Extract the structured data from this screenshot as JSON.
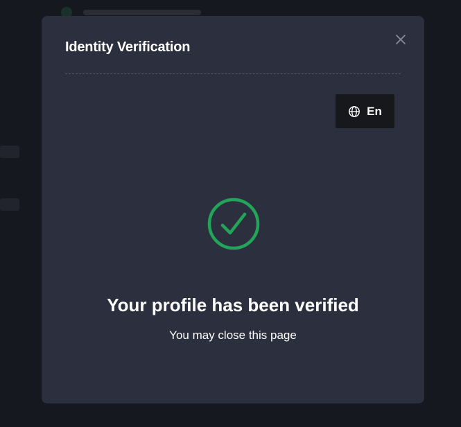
{
  "modal": {
    "title": "Identity Verification",
    "close_icon": "close-icon",
    "language": {
      "icon": "globe-icon",
      "label": "En"
    },
    "status": {
      "icon": "check-circle-icon",
      "headline": "Your profile has been verified",
      "message": "You may close this page"
    }
  },
  "colors": {
    "modal_background": "#2b2f3e",
    "page_background": "#161820",
    "success": "#22a559",
    "language_button": "#17181c",
    "text": "#ffffff"
  }
}
